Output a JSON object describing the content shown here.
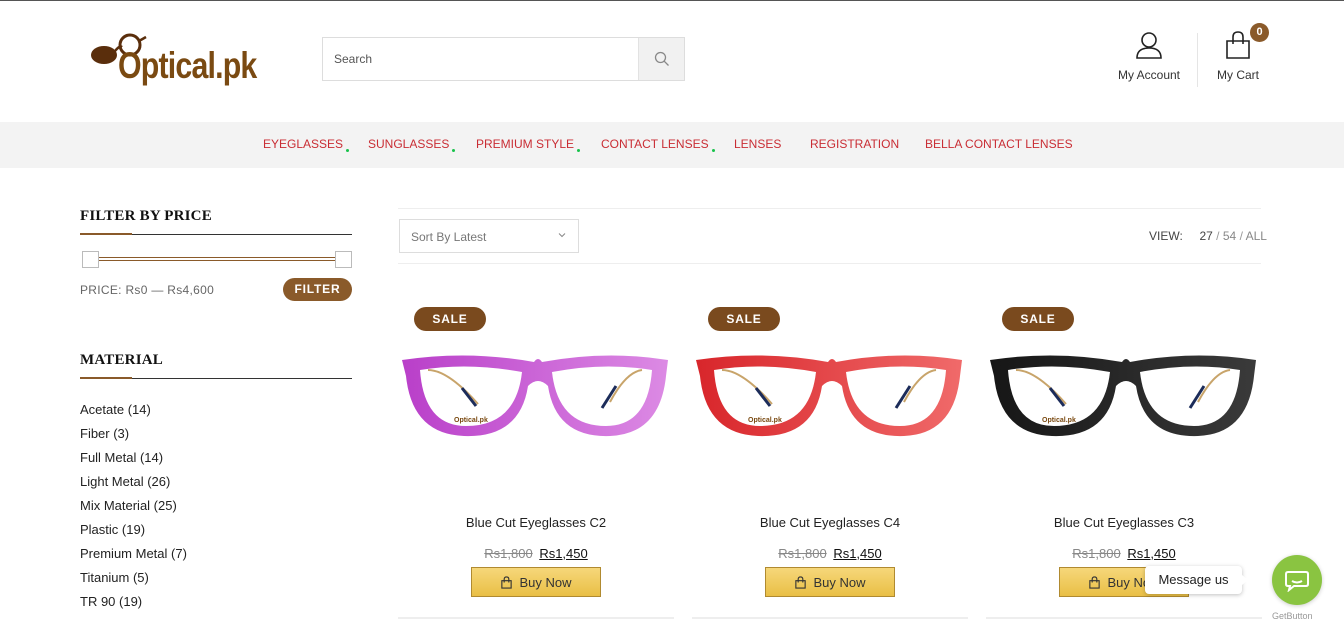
{
  "header": {
    "logo_text": "Optical.pk",
    "search_placeholder": "Search",
    "account_label": "My Account",
    "cart_label": "My Cart",
    "cart_count": "0"
  },
  "nav": {
    "items": [
      {
        "label": "EYEGLASSES",
        "has_dropdown": true
      },
      {
        "label": "SUNGLASSES",
        "has_dropdown": true
      },
      {
        "label": "PREMIUM STYLE",
        "has_dropdown": true
      },
      {
        "label": "CONTACT LENSES",
        "has_dropdown": true
      },
      {
        "label": "LENSES",
        "has_dropdown": false
      },
      {
        "label": "REGISTRATION",
        "has_dropdown": false
      },
      {
        "label": "BELLA CONTACT LENSES",
        "has_dropdown": false
      }
    ]
  },
  "sidebar": {
    "price_title": "FILTER BY PRICE",
    "price_text": "PRICE: Rs0 — Rs4,600",
    "filter_button": "FILTER",
    "material_title": "MATERIAL",
    "materials": [
      "Acetate (14)",
      "Fiber (3)",
      "Full Metal (14)",
      "Light Metal (26)",
      "Mix Material (25)",
      "Plastic (19)",
      "Premium Metal (7)",
      "Titanium (5)",
      "TR 90 (19)"
    ]
  },
  "toolbar": {
    "sort_value": "Sort By Latest",
    "view_label": "VIEW:",
    "view_current": "27",
    "view_opt_54": "54",
    "view_opt_all": "ALL",
    "sep": "/"
  },
  "products": [
    {
      "name": "Blue Cut Eyeglasses C2",
      "old_price": "Rs1,800",
      "new_price": "Rs1,450",
      "badge": "SALE",
      "buy_label": "Buy Now",
      "frame_color": "#b93fc9",
      "frame_light": "#dc8ae4"
    },
    {
      "name": "Blue Cut Eyeglasses C4",
      "old_price": "Rs1,800",
      "new_price": "Rs1,450",
      "badge": "SALE",
      "buy_label": "Buy Now",
      "frame_color": "#d8262b",
      "frame_light": "#f06a6a"
    },
    {
      "name": "Blue Cut Eyeglasses C3",
      "old_price": "Rs1,800",
      "new_price": "Rs1,450",
      "badge": "SALE",
      "buy_label": "Buy Now",
      "frame_color": "#161616",
      "frame_light": "#3a3a3a"
    }
  ],
  "chat": {
    "message_label": "Message us",
    "brand": "GetButton"
  },
  "colors": {
    "brand_brown": "#8a5a2a",
    "nav_red": "#c92d34",
    "buy_gold": "#e9bf45",
    "chat_green": "#8ac441"
  }
}
